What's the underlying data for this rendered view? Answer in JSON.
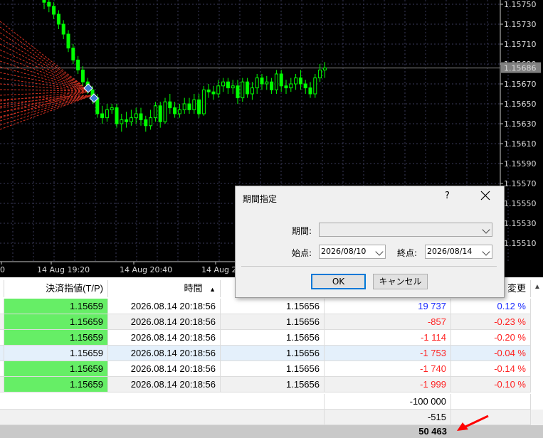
{
  "chart": {
    "price_axis": [
      "1.15750",
      "1.15730",
      "1.15710",
      "1.15690",
      "1.15670",
      "1.15650",
      "1.15630",
      "1.15610",
      "1.15590",
      "1.15570",
      "1.15550",
      "1.15530",
      "1.15510"
    ],
    "current_price": "1.15686",
    "time_axis": [
      "0",
      "14 Aug 19:20",
      "14 Aug 20:40",
      "14 Aug 2"
    ],
    "colors": {
      "background": "#000000",
      "candle": "#00ff00",
      "grid": "#3a3a5a",
      "fan_lines": "#d03020"
    }
  },
  "table": {
    "headers": {
      "tp": "決済指値(T/P)",
      "time": "時間",
      "sort_icon": "▲",
      "change": "変更"
    },
    "rows": [
      {
        "tp": "1.15659",
        "time": "2026.08.14 20:18:56",
        "price": "1.15656",
        "profit": "19 737",
        "change": "0.12 %",
        "sign": "pos",
        "tp_green": true
      },
      {
        "tp": "1.15659",
        "time": "2026.08.14 20:18:56",
        "price": "1.15656",
        "profit": "-857",
        "change": "-0.23 %",
        "sign": "neg",
        "tp_green": true
      },
      {
        "tp": "1.15659",
        "time": "2026.08.14 20:18:56",
        "price": "1.15656",
        "profit": "-1 114",
        "change": "-0.20 %",
        "sign": "neg",
        "tp_green": true
      },
      {
        "tp": "1.15659",
        "time": "2026.08.14 20:18:56",
        "price": "1.15656",
        "profit": "-1 753",
        "change": "-0.04 %",
        "sign": "neg",
        "tp_green": false,
        "selected": true
      },
      {
        "tp": "1.15659",
        "time": "2026.08.14 20:18:56",
        "price": "1.15656",
        "profit": "-1 740",
        "change": "-0.14 %",
        "sign": "neg",
        "tp_green": true
      },
      {
        "tp": "1.15659",
        "time": "2026.08.14 20:18:56",
        "price": "1.15656",
        "profit": "-1 999",
        "change": "-0.10 %",
        "sign": "neg",
        "tp_green": true
      }
    ],
    "summary": [
      "-100 000",
      "-515"
    ],
    "total": "50 463"
  },
  "dialog": {
    "title": "期間指定",
    "help": "?",
    "period_label": "期間:",
    "period_value": "",
    "start_label": "始点:",
    "start_value": "2026/08/10",
    "end_label": "終点:",
    "end_value": "2026/08/14",
    "ok": "OK",
    "cancel": "キャンセル"
  }
}
